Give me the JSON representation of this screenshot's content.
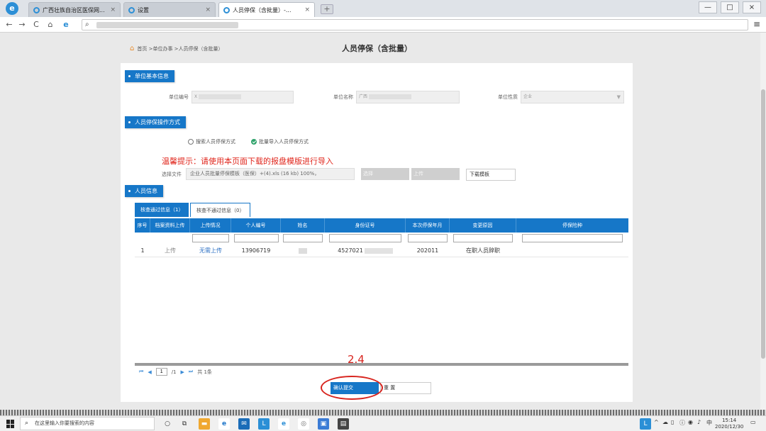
{
  "browser": {
    "tabs": [
      {
        "title": "广西壮族自治区医保网...",
        "close": "×"
      },
      {
        "title": "设置",
        "close": "×"
      },
      {
        "title": "人员停保（含批量）-...",
        "close": "×"
      }
    ],
    "newtab": "+",
    "window_buttons": [
      "—",
      "□",
      "×"
    ],
    "nav": {
      "back": "←",
      "forward": "→",
      "reload": "C",
      "home": "⌂",
      "menu": "≡"
    }
  },
  "page": {
    "breadcrumb": "首页 >单位办事 >人员停保（含批量）",
    "title": "人员停保（含批量）"
  },
  "unit_info": {
    "section_title": "单位基本信息",
    "fields": [
      {
        "label": "单位编号",
        "value": "X"
      },
      {
        "label": "单位名称",
        "value": "广西"
      },
      {
        "label": "单位性质",
        "value": "企业"
      }
    ]
  },
  "operation": {
    "section_title": "人员停保操作方式",
    "radio_options": [
      "搜索人员停保方式",
      "批量导入人员停保方式"
    ],
    "selected": 1,
    "tip": "温馨提示：请使用本页面下载的报盘模版进行导入",
    "file_label": "选择文件",
    "file_value": "企业人员批量停保模板（医保）+(4).xls (16 kb) 100%，",
    "choose_button": "选择",
    "upload_button": "上传",
    "download_button": "下载模板"
  },
  "people": {
    "section_title": "人员信息",
    "tabs": [
      "核查通过信息（1）",
      "核查不通过信息（0）"
    ],
    "columns": [
      "序号",
      "档案资料上传",
      "上传情况",
      "个人编号",
      "姓名",
      "身份证号",
      "本次停保年月",
      "变更原因",
      "停保险种"
    ],
    "rows": [
      [
        "1",
        "上传",
        "无需上传",
        "13906719",
        "",
        "4527021",
        "202011",
        "在职人员辞职",
        ""
      ]
    ]
  },
  "pager": {
    "first": "⏮",
    "prev": "◀",
    "page": "1",
    "total_pages": "/1",
    "next": "▶",
    "last": "⏭",
    "total": "共 1条"
  },
  "actions": {
    "submit": "确认提交",
    "reset": "重 置"
  },
  "annotation": {
    "label": "2.4"
  },
  "taskbar": {
    "search_placeholder": "在这里输入你要搜索的内容",
    "tray_lang": "中",
    "time": "15:14",
    "date": "2020/12/30"
  },
  "colors": {
    "primary": "#1677c8",
    "tip": "#e0251b",
    "annotation": "#d8241e"
  }
}
